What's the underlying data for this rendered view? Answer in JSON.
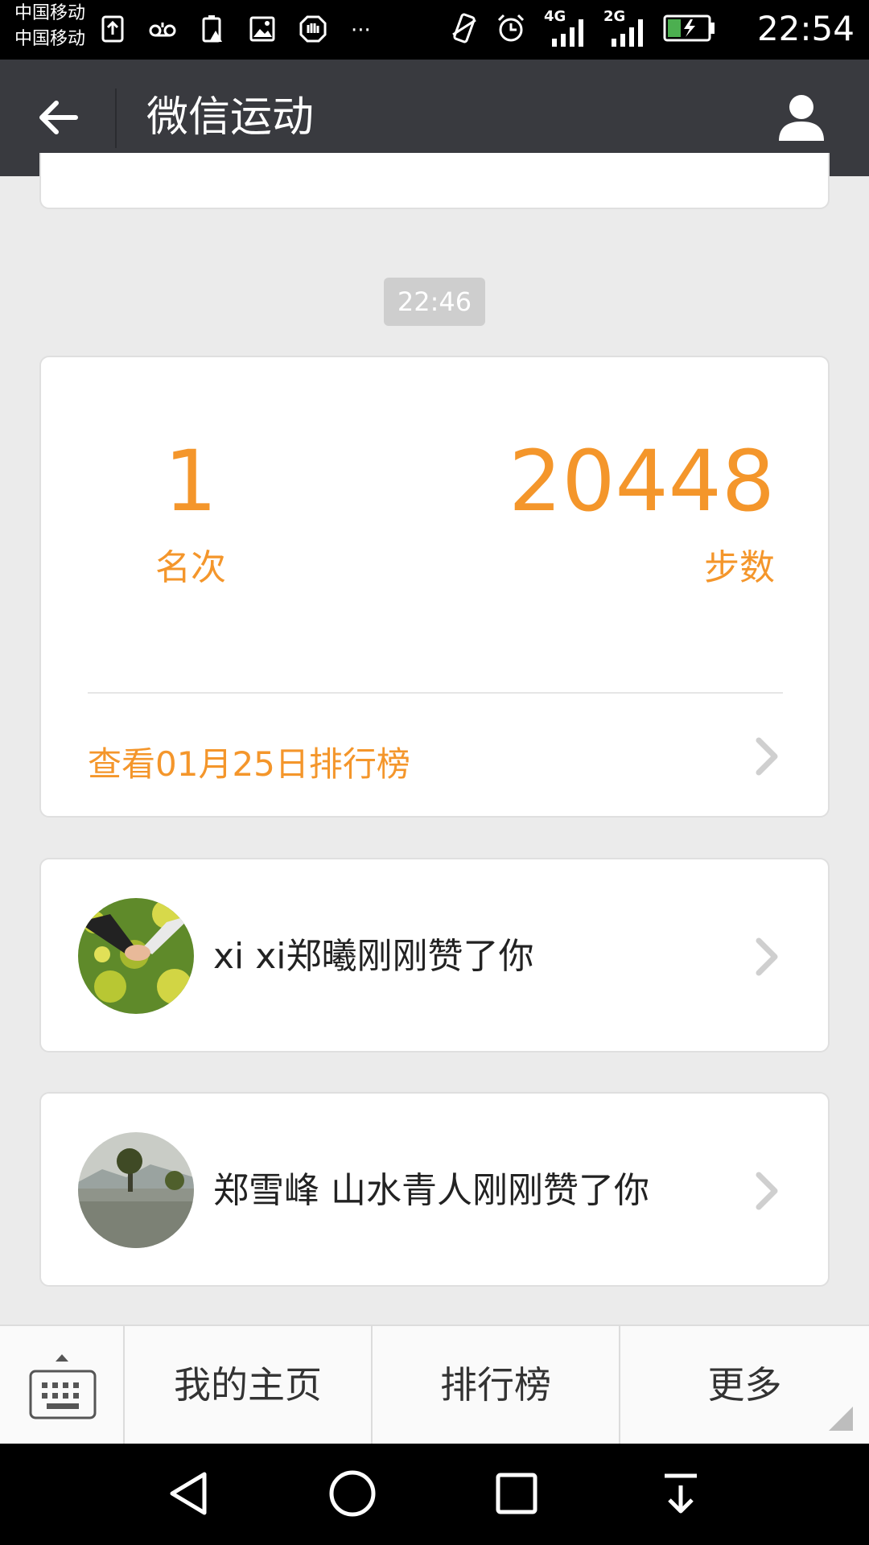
{
  "status_bar": {
    "carrier_1": "中国移动",
    "carrier_2": "中国移动",
    "network_1": "4G",
    "network_2": "2G",
    "time": "22:54"
  },
  "header": {
    "title": "微信运动"
  },
  "timestamp": "22:46",
  "ranking": {
    "rank": "1",
    "rank_label": "名次",
    "steps": "20448",
    "steps_label": "步数",
    "leaderboard_link": "查看01月25日排行榜"
  },
  "likes": [
    {
      "text": "xi xi郑曦刚刚赞了你"
    },
    {
      "text": "郑雪峰  山水青人刚刚赞了你"
    }
  ],
  "bottom_menu": {
    "items": [
      {
        "label": "我的主页"
      },
      {
        "label": "排行榜"
      },
      {
        "label": "更多"
      }
    ]
  },
  "colors": {
    "accent": "#f4962b",
    "titlebar": "#393a3f",
    "background": "#ebebeb"
  }
}
